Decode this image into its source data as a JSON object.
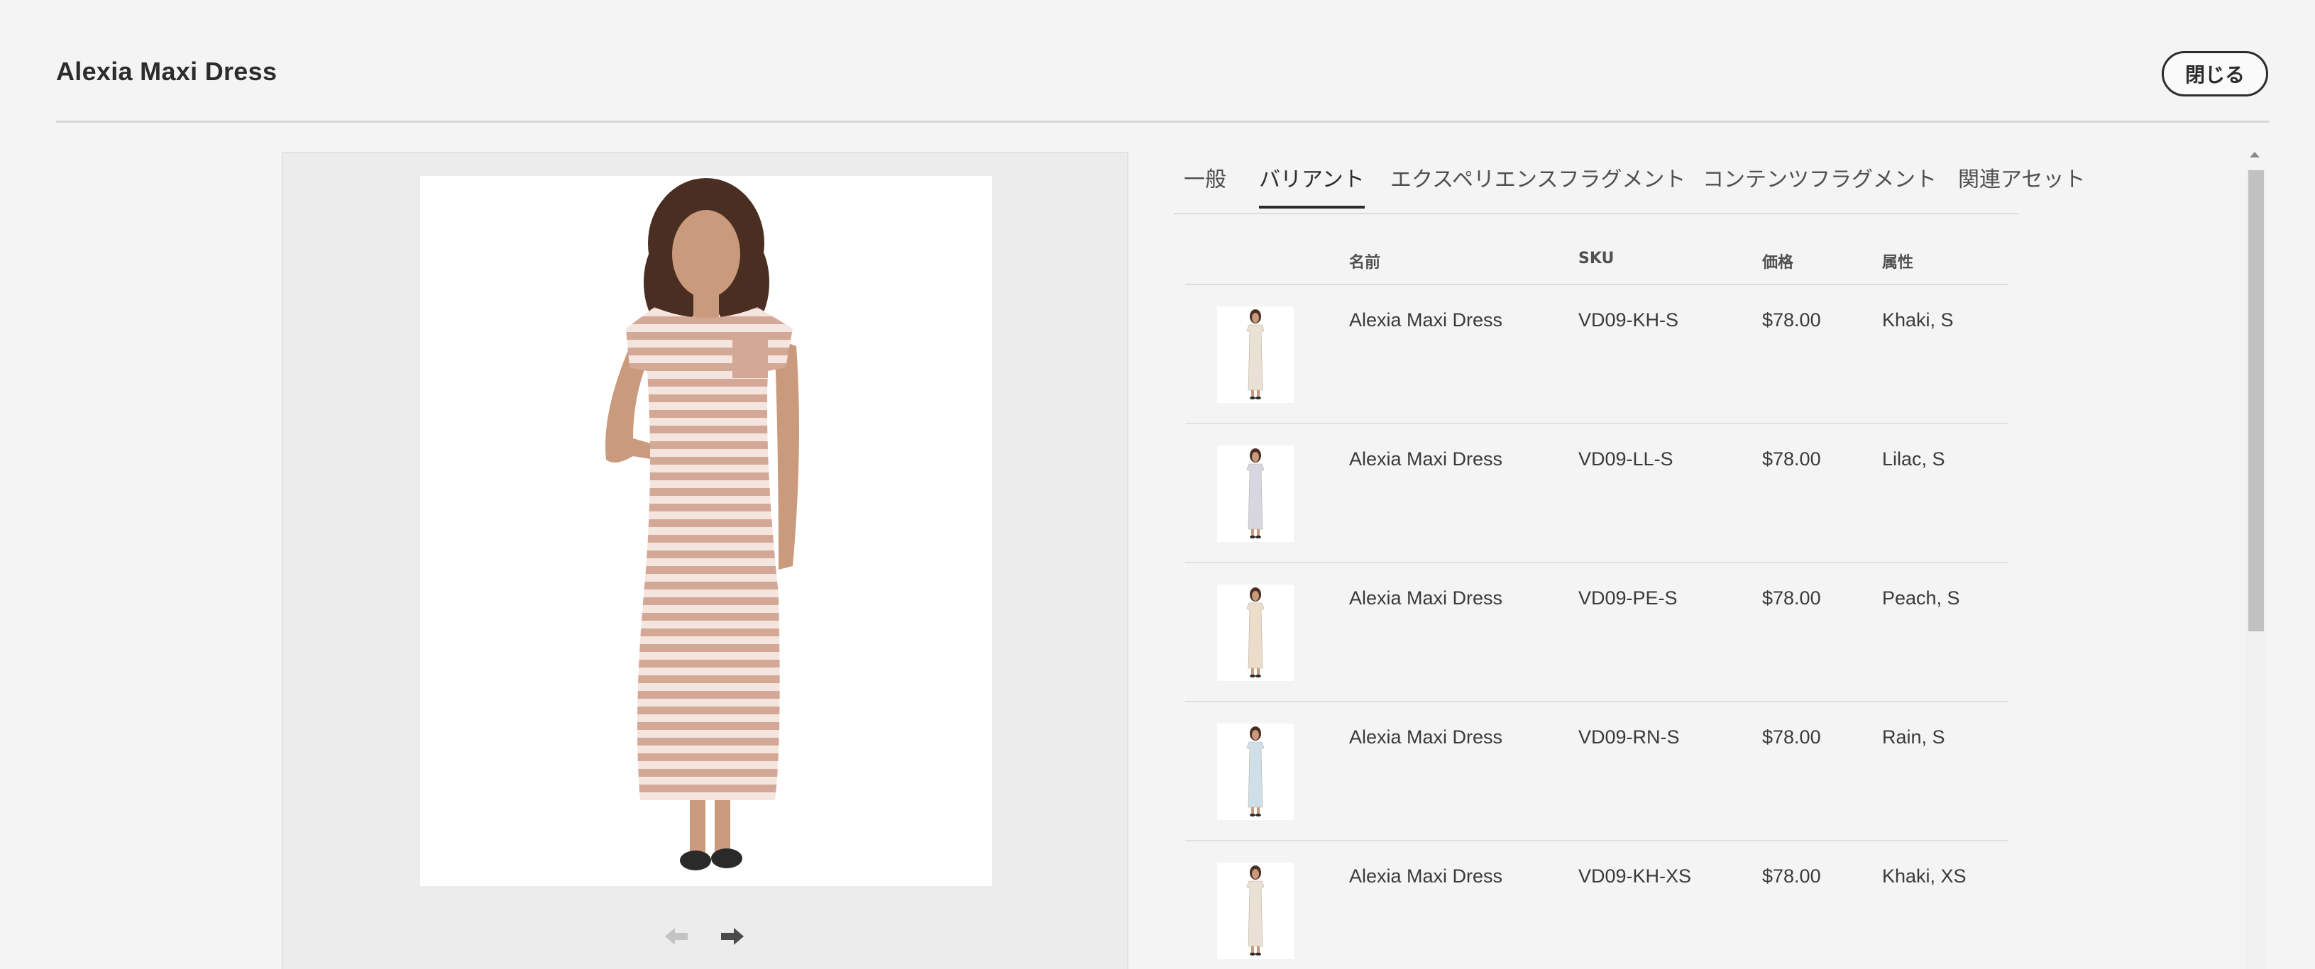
{
  "header": {
    "title": "Alexia Maxi Dress",
    "close_label": "閉じる"
  },
  "media": {
    "image_alt": "Alexia Maxi Dress",
    "prev_icon": "arrow-left-icon",
    "next_icon": "arrow-right-icon"
  },
  "tabs": [
    {
      "label": "一般",
      "active": false
    },
    {
      "label": "バリアント",
      "active": true
    },
    {
      "label": "エクスペリエンスフラグメント",
      "active": false
    },
    {
      "label": "コンテンツフラグメント",
      "active": false
    },
    {
      "label": "関連アセット",
      "active": false
    }
  ],
  "table": {
    "headers": {
      "name": "名前",
      "sku": "SKU",
      "price": "価格",
      "attributes": "属性"
    },
    "rows": [
      {
        "name": "Alexia Maxi Dress",
        "sku": "VD09-KH-S",
        "price": "$78.00",
        "attributes": "Khaki, S",
        "dress_color": "#e8e1d4"
      },
      {
        "name": "Alexia Maxi Dress",
        "sku": "VD09-LL-S",
        "price": "$78.00",
        "attributes": "Lilac, S",
        "dress_color": "#d8d6e0"
      },
      {
        "name": "Alexia Maxi Dress",
        "sku": "VD09-PE-S",
        "price": "$78.00",
        "attributes": "Peach, S",
        "dress_color": "#ecdcca"
      },
      {
        "name": "Alexia Maxi Dress",
        "sku": "VD09-RN-S",
        "price": "$78.00",
        "attributes": "Rain, S",
        "dress_color": "#cfdfe8"
      },
      {
        "name": "Alexia Maxi Dress",
        "sku": "VD09-KH-XS",
        "price": "$78.00",
        "attributes": "Khaki, XS",
        "dress_color": "#e8e1d4"
      }
    ]
  },
  "colors": {
    "background": "#f4f4f4",
    "panel": "#ececec",
    "text": "#2c2c2c",
    "divider": "#dcdcdc",
    "main_dress_stripe": "#d4a897"
  }
}
